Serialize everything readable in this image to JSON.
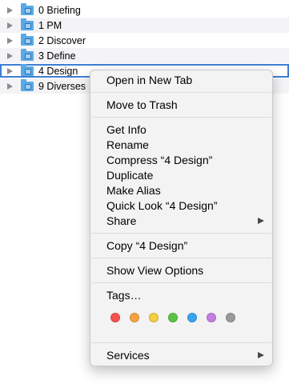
{
  "finder": {
    "rows": [
      {
        "label": "0 Briefing"
      },
      {
        "label": "1 PM"
      },
      {
        "label": "2 Discover"
      },
      {
        "label": "3 Define"
      },
      {
        "label": "4 Design",
        "selected": true
      },
      {
        "label": "9 Diverses"
      }
    ]
  },
  "context_menu": {
    "open_new_tab": "Open in New Tab",
    "move_to_trash": "Move to Trash",
    "get_info": "Get Info",
    "rename": "Rename",
    "compress": "Compress “4 Design”",
    "duplicate": "Duplicate",
    "make_alias": "Make Alias",
    "quick_look": "Quick Look “4 Design”",
    "share": "Share",
    "copy": "Copy “4 Design”",
    "show_view_options": "Show View Options",
    "tags": "Tags…",
    "services": "Services",
    "tag_colors": [
      {
        "name": "red",
        "color": "#f5524c"
      },
      {
        "name": "orange",
        "color": "#f6a33d"
      },
      {
        "name": "yellow",
        "color": "#f5cd41"
      },
      {
        "name": "green",
        "color": "#5cc246"
      },
      {
        "name": "blue",
        "color": "#3aa3f0"
      },
      {
        "name": "purple",
        "color": "#c57ee1"
      },
      {
        "name": "gray",
        "color": "#9a9a9a"
      }
    ]
  }
}
